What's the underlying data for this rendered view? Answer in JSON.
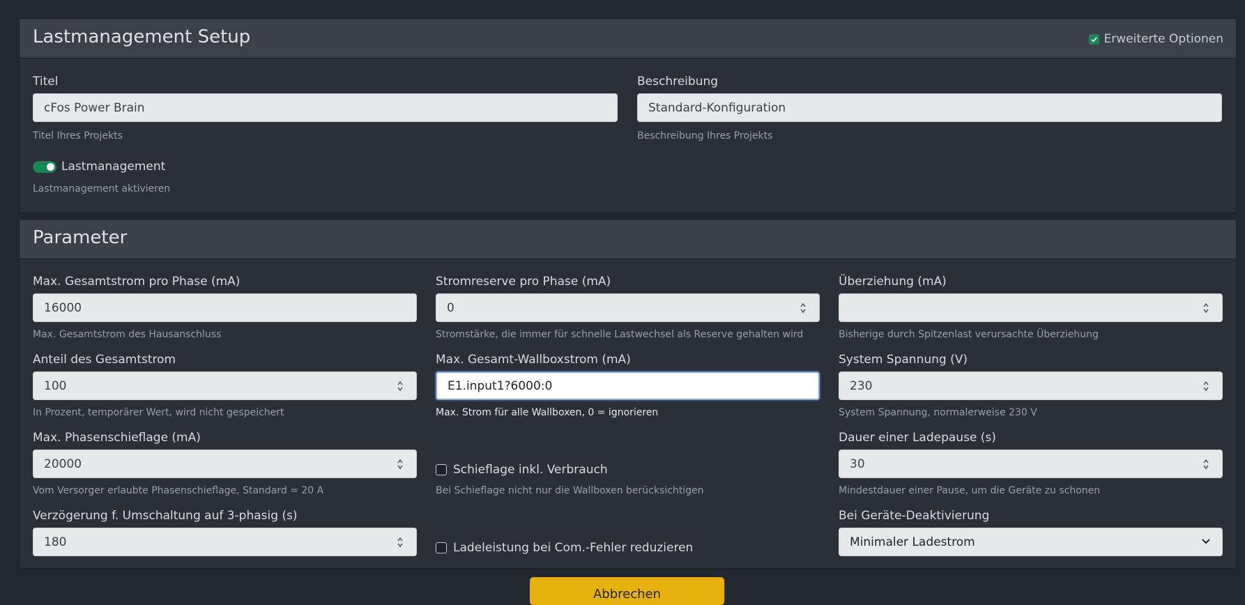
{
  "setup": {
    "title": "Lastmanagement Setup",
    "advanced_label": "Erweiterte Optionen",
    "advanced_checked": true,
    "titel_label": "Titel",
    "titel_value": "cFos Power Brain",
    "titel_help": "Titel Ihres Projekts",
    "beschreibung_label": "Beschreibung",
    "beschreibung_value": "Standard-Konfiguration",
    "beschreibung_help": "Beschreibung Ihres Projekts",
    "lm_label": "Lastmanagement",
    "lm_help": "Lastmanagement aktivieren",
    "lm_enabled": true
  },
  "params": {
    "title": "Parameter",
    "max_gesamt_label": "Max. Gesamtstrom pro Phase (mA)",
    "max_gesamt_value": "16000",
    "max_gesamt_help": "Max. Gesamtstrom des Hausanschluss",
    "reserve_label": "Stromreserve pro Phase (mA)",
    "reserve_value": "0",
    "reserve_help": "Stromstärke, die immer für schnelle Lastwechsel als Reserve gehalten wird",
    "ueberziehung_label": "Überziehung (mA)",
    "ueberziehung_value": "",
    "ueberziehung_help": "Bisherige durch Spitzenlast verursachte Überziehung",
    "anteil_label": "Anteil des Gesamtstrom",
    "anteil_value": "100",
    "anteil_help": "In Prozent, temporärer Wert, wird nicht gespeichert",
    "wallbox_label": "Max. Gesamt-Wallboxstrom (mA)",
    "wallbox_value": "E1.input1?6000:0",
    "wallbox_help": "Max. Strom für alle Wallboxen, 0 = ignorieren",
    "spannung_label": "System Spannung (V)",
    "spannung_value": "230",
    "spannung_help": "System Spannung, normalerweise 230 V",
    "schieflage_label": "Max. Phasenschieflage (mA)",
    "schieflage_value": "20000",
    "schieflage_help": "Vom Versorger erlaubte Phasenschieflage, Standard = 20 A",
    "schieflage_verbrauch_label": "Schieflage inkl. Verbrauch",
    "schieflage_verbrauch_help": "Bei Schieflage nicht nur die Wallboxen berücksichtigen",
    "schieflage_verbrauch_checked": false,
    "ladepause_label": "Dauer einer Ladepause (s)",
    "ladepause_value": "30",
    "ladepause_help": "Mindestdauer einer Pause, um die Geräte zu schonen",
    "verzoegerung_label": "Verzögerung f. Umschaltung auf 3-phasig (s)",
    "verzoegerung_value": "180",
    "comfehler_label": "Ladeleistung bei Com.-Fehler reduzieren",
    "comfehler_checked": false,
    "deaktivierung_label": "Bei Geräte-Deaktivierung",
    "deaktivierung_value": "Minimaler Ladestrom"
  },
  "save_label": "Abbrechen"
}
